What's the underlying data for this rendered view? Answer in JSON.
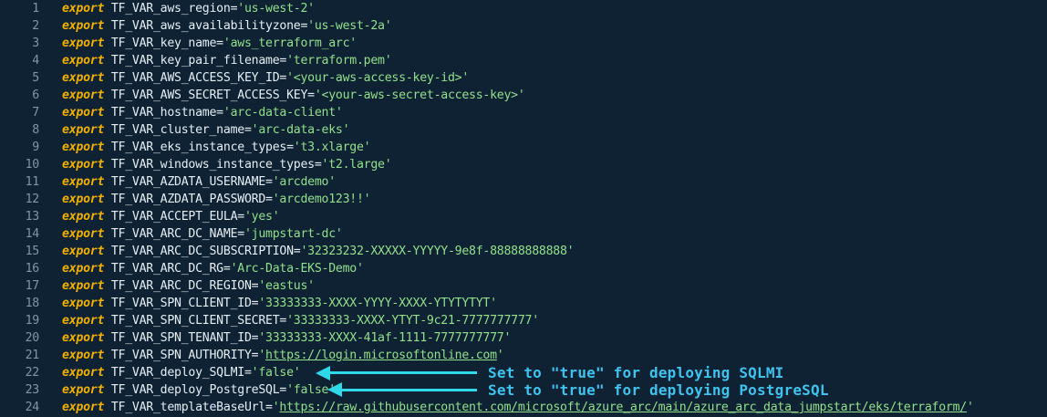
{
  "editor": {
    "lines": [
      {
        "num": "1",
        "kw": "export",
        "name": "TF_VAR_aws_region=",
        "val": "'us-west-2'",
        "url": "",
        "tail": ""
      },
      {
        "num": "2",
        "kw": "export",
        "name": "TF_VAR_aws_availabilityzone=",
        "val": "'us-west-2a'",
        "url": "",
        "tail": ""
      },
      {
        "num": "3",
        "kw": "export",
        "name": "TF_VAR_key_name=",
        "val": "'aws_terraform_arc'",
        "url": "",
        "tail": ""
      },
      {
        "num": "4",
        "kw": "export",
        "name": "TF_VAR_key_pair_filename=",
        "val": "'terraform.pem'",
        "url": "",
        "tail": ""
      },
      {
        "num": "5",
        "kw": "export",
        "name": "TF_VAR_AWS_ACCESS_KEY_ID=",
        "val": "'<your-aws-access-key-id>'",
        "url": "",
        "tail": ""
      },
      {
        "num": "6",
        "kw": "export",
        "name": "TF_VAR_AWS_SECRET_ACCESS_KEY=",
        "val": "'<your-aws-secret-access-key>'",
        "url": "",
        "tail": ""
      },
      {
        "num": "7",
        "kw": "export",
        "name": "TF_VAR_hostname=",
        "val": "'arc-data-client'",
        "url": "",
        "tail": ""
      },
      {
        "num": "8",
        "kw": "export",
        "name": "TF_VAR_cluster_name=",
        "val": "'arc-data-eks'",
        "url": "",
        "tail": ""
      },
      {
        "num": "9",
        "kw": "export",
        "name": "TF_VAR_eks_instance_types=",
        "val": "'t3.xlarge'",
        "url": "",
        "tail": ""
      },
      {
        "num": "10",
        "kw": "export",
        "name": "TF_VAR_windows_instance_types=",
        "val": "'t2.large'",
        "url": "",
        "tail": ""
      },
      {
        "num": "11",
        "kw": "export",
        "name": "TF_VAR_AZDATA_USERNAME=",
        "val": "'arcdemo'",
        "url": "",
        "tail": ""
      },
      {
        "num": "12",
        "kw": "export",
        "name": "TF_VAR_AZDATA_PASSWORD=",
        "val": "'arcdemo123!!'",
        "url": "",
        "tail": ""
      },
      {
        "num": "13",
        "kw": "export",
        "name": "TF_VAR_ACCEPT_EULA=",
        "val": "'yes'",
        "url": "",
        "tail": ""
      },
      {
        "num": "14",
        "kw": "export",
        "name": "TF_VAR_ARC_DC_NAME=",
        "val": "'jumpstart-dc'",
        "url": "",
        "tail": ""
      },
      {
        "num": "15",
        "kw": "export",
        "name": "TF_VAR_ARC_DC_SUBSCRIPTION=",
        "val": "'32323232-XXXXX-YYYYY-9e8f-88888888888'",
        "url": "",
        "tail": ""
      },
      {
        "num": "16",
        "kw": "export",
        "name": "TF_VAR_ARC_DC_RG=",
        "val": "'Arc-Data-EKS-Demo'",
        "url": "",
        "tail": ""
      },
      {
        "num": "17",
        "kw": "export",
        "name": "TF_VAR_ARC_DC_REGION=",
        "val": "'eastus'",
        "url": "",
        "tail": ""
      },
      {
        "num": "18",
        "kw": "export",
        "name": "TF_VAR_SPN_CLIENT_ID=",
        "val": "'33333333-XXXX-YYYY-XXXX-YTYTYTYT'",
        "url": "",
        "tail": ""
      },
      {
        "num": "19",
        "kw": "export",
        "name": "TF_VAR_SPN_CLIENT_SECRET=",
        "val": "'33333333-XXXX-YTYT-9c21-7777777777'",
        "url": "",
        "tail": ""
      },
      {
        "num": "20",
        "kw": "export",
        "name": "TF_VAR_SPN_TENANT_ID=",
        "val": "'33333333-XXXX-41af-1111-7777777777'",
        "url": "",
        "tail": ""
      },
      {
        "num": "21",
        "kw": "export",
        "name": "TF_VAR_SPN_AUTHORITY=",
        "val": "'",
        "url": "https://login.microsoftonline.com",
        "tail": "'"
      },
      {
        "num": "22",
        "kw": "export",
        "name": "TF_VAR_deploy_SQLMI=",
        "val": "'false'",
        "url": "",
        "tail": ""
      },
      {
        "num": "23",
        "kw": "export",
        "name": "TF_VAR_deploy_PostgreSQL=",
        "val": "'false'",
        "url": "",
        "tail": ""
      },
      {
        "num": "24",
        "kw": "export",
        "name": "TF_VAR_templateBaseUrl=",
        "val": "'",
        "url": "https://raw.githubusercontent.com/microsoft/azure_arc/main/azure_arc_data_jumpstart/eks/terraform/",
        "tail": "'"
      }
    ]
  },
  "annotations": {
    "sqlmi_note": "Set to \"true\" for deploying SQLMI",
    "postgres_note": "Set to \"true\" for deploying PostgreSQL"
  },
  "colors": {
    "background": "#0e2233",
    "keyword": "#f0b000",
    "string": "#93e08c",
    "annotation": "#3fc3ee",
    "arrow": "#2fd9e8"
  }
}
